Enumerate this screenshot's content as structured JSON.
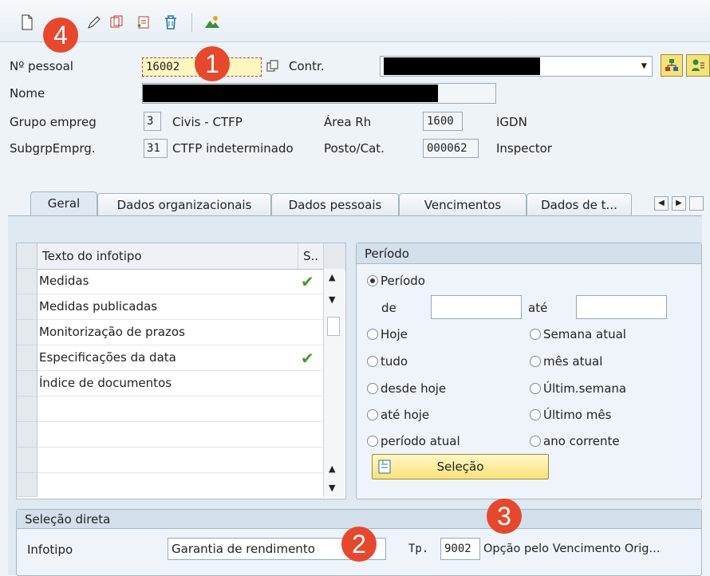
{
  "toolbar": {
    "icons": [
      "new-document-icon",
      "change-pencil-icon",
      "copy-icon",
      "delimit-icon",
      "delete-icon",
      "overview-icon"
    ]
  },
  "header": {
    "personnel_label": "Nº pessoal",
    "personnel_value": "16002",
    "contract_label": "Contr.",
    "name_label": "Nome",
    "employee_group_label": "Grupo empreg",
    "employee_group_code": "3",
    "employee_group_text": "Civis - CTFP",
    "personnel_area_label": "Área Rh",
    "personnel_area_code": "1600",
    "personnel_area_text": "IGDN",
    "subgroup_label": "SubgrpEmprg.",
    "subgroup_code": "31",
    "subgroup_text": "CTFP indeterminado",
    "position_label": "Posto/Cat.",
    "position_code": "000062",
    "position_text": "Inspector"
  },
  "tabs": [
    "Geral",
    "Dados organizacionais",
    "Dados pessoais",
    "Vencimentos",
    "Dados de t..."
  ],
  "infotype_table": {
    "col_text": "Texto do infotipo",
    "col_status": "S..",
    "rows": [
      {
        "label": "Medidas",
        "checked": true
      },
      {
        "label": "Medidas publicadas",
        "checked": false
      },
      {
        "label": "Monitorização de prazos",
        "checked": false
      },
      {
        "label": "Especificações da data",
        "checked": true
      },
      {
        "label": "Índice de documentos",
        "checked": false
      }
    ]
  },
  "period": {
    "title": "Período",
    "period_option": "Período",
    "from_label": "de",
    "to_label": "até",
    "from_value": "",
    "to_value": "",
    "options_left": [
      "Hoje",
      "tudo",
      "desde hoje",
      "até hoje",
      "período atual"
    ],
    "options_right": [
      "Semana atual",
      "mês atual",
      "Últim.semana",
      "Último mês",
      "ano corrente"
    ],
    "selection_button": "Seleção"
  },
  "direct_selection": {
    "title": "Seleção direta",
    "infotype_label": "Infotipo",
    "infotype_value": "Garantia de rendimento",
    "type_label": "Tp.",
    "type_value": "9002",
    "type_text": "Opção pelo Vencimento Orig..."
  },
  "markers": [
    "1",
    "2",
    "3",
    "4"
  ],
  "colors": {
    "marker": "#e6482e",
    "selection_button": "#f7e27a",
    "check": "#4a9a2e"
  }
}
